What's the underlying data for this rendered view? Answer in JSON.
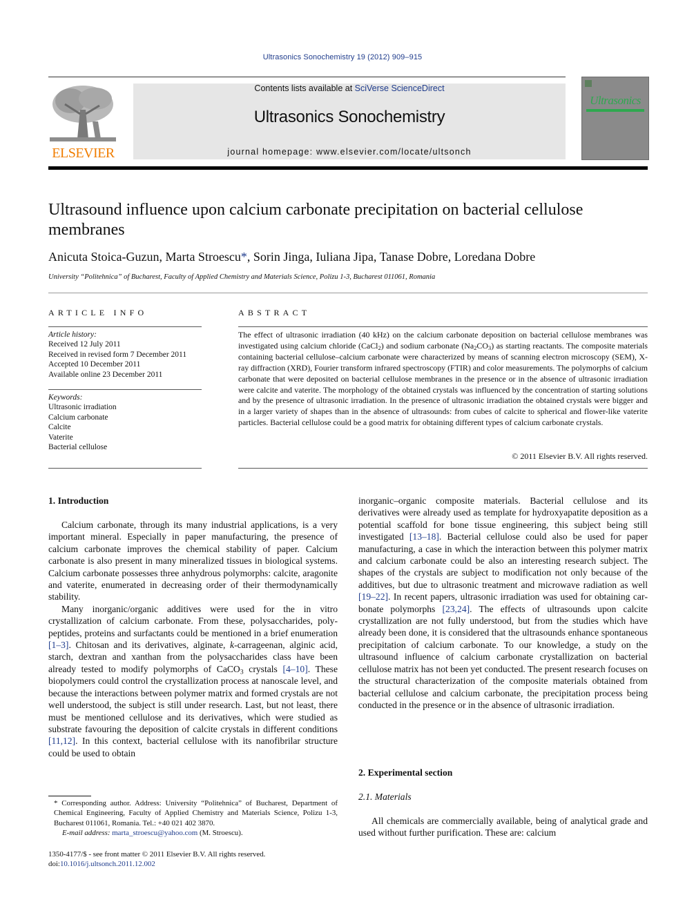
{
  "running_header": "Ultrasonics Sonochemistry 19 (2012) 909–915",
  "masthead": {
    "contents_prefix": "Contents lists available at ",
    "contents_link": "SciVerse ScienceDirect",
    "journal_name": "Ultrasonics Sonochemistry",
    "homepage_prefix": "journal homepage: ",
    "homepage_url": "www.elsevier.com/locate/ultsonch",
    "publisher_logo_text": "ELSEVIER",
    "cover_title": "Ultrasonics",
    "colors": {
      "masthead_bg": "#e6e6e6",
      "elsevier_orange": "#f07d00",
      "link_blue": "#1f3c8c",
      "cover_green": "#2fa84f",
      "cover_gray": "#8a8a8a"
    }
  },
  "article": {
    "title": "Ultrasound influence upon calcium carbonate precipitation on bacterial cellulose membranes",
    "authors_before_star": "Anicuta Stoica-Guzun, Marta Stroescu",
    "corresponding_marker": "*",
    "authors_after_star": ", Sorin Jinga, Iuliana Jipa, Tanase Dobre, Loredana Dobre",
    "affiliation": "University “Politehnica” of Bucharest, Faculty of Applied Chemistry and Materials Science, Polizu 1-3, Bucharest 011061, Romania"
  },
  "article_info": {
    "heading": "ARTICLE INFO",
    "history_label": "Article history:",
    "history": [
      "Received 12 July 2011",
      "Received in revised form 7 December 2011",
      "Accepted 10 December 2011",
      "Available online 23 December 2011"
    ],
    "keywords_label": "Keywords:",
    "keywords": [
      "Ultrasonic irradiation",
      "Calcium carbonate",
      "Calcite",
      "Vaterite",
      "Bacterial cellulose"
    ]
  },
  "abstract": {
    "heading": "ABSTRACT",
    "part1": "The effect of ultrasonic irradiation (40 kHz) on the calcium carbonate deposition on bacterial cellulose membranes was investigated using calcium chloride (CaCl",
    "sub1": "2",
    "part2": ") and sodium carbonate (Na",
    "sub2": "2",
    "part3": "CO",
    "sub3": "3",
    "part4": ") as starting reactants. The composite materials containing bacterial cellulose–calcium carbonate were characterized by means of scanning electron microscopy (SEM), X-ray diffraction (XRD), Fourier transform infrared spectroscopy (FTIR) and color measurements. The polymorphs of calcium carbonate that were deposited on bacterial cellulose membranes in the presence or in the absence of ultrasonic irradiation were calcite and vaterite. The morphology of the obtained crystals was influenced by the concentration of starting solutions and by the presence of ultrasonic irradiation. In the presence of ultrasonic irradiation the obtained crystals were bigger and in a larger variety of shapes than in the absence of ultrasounds: from cubes of calcite to spherical and flower-like vaterite particles. Bacterial cellulose could be a good matrix for obtaining different types of calcium carbonate crystals.",
    "copyright": "© 2011 Elsevier B.V. All rights reserved."
  },
  "sections": {
    "intro_heading": "1. Introduction",
    "intro_p1": "Calcium carbonate, through its many industrial applications, is a very important mineral. Especially in paper manufacturing, the presence of calcium carbonate improves the chemical stability of paper. Calcium carbonate is also present in many mineralized tis­sues in biological systems. Calcium carbonate possesses three anhydrous polymorphs: calcite, aragonite and vaterite, enumer­ated in decreasing order of their thermodynamically stability.",
    "intro_p2_a": "Many inorganic/organic additives were used for the in vitro crystallization of calcium carbonate. From these, polysaccharides, poly-peptides, proteins and surfactants could be mentioned in a brief enumeration ",
    "ref_1_3": "[1–3]",
    "intro_p2_b": ". Chitosan and its derivatives, alginate, ",
    "intro_p2_k": "k",
    "intro_p2_c": "-carrageenan, alginic acid, starch, dextran and xanthan from the polysaccharides class have been already tested to modify poly­morphs of CaCO",
    "intro_p2_sub": "3",
    "intro_p2_d": " crystals ",
    "ref_4_10": "[4–10]",
    "intro_p2_e": ". These biopolymers could control the crystallization process at nanoscale level, and because the interactions between polymer matrix and formed crystals are not well understood, the subject is still under research. Last, but not least, there must be mentioned cellulose and its derivatives, which were studied as substrate favouring the deposition of calcite crys­tals in different conditions ",
    "ref_11_12": "[11,12]",
    "intro_p2_f": ". In this context, bacterial cellu­lose with its nanofibrilar structure could be used to obtain",
    "right_a": "inorganic–organic composite materials. Bacterial cellulose and its derivatives were already used as template for hydroxyapatite deposition as a potential scaffold for bone tissue engineering, this subject being still investigated ",
    "ref_13_18": "[13–18]",
    "right_b": ". Bacterial cellulose could also be used for paper manufacturing, a case in which the interac­tion between this polymer matrix and calcium carbonate could be also an interesting research subject. The shapes of the crystals are subject to modification not only because of the additives, but due to ultrasonic treatment and microwave radiation as well ",
    "ref_19_22": "[19–22]",
    "right_c": ". In recent papers, ultrasonic irradiation was used for obtaining car­bonate polymorphs ",
    "ref_23_24": "[23,24]",
    "right_d": ". The effects of ultrasounds upon calcite crystallization are not fully understood, but from the studies which have already been done, it is considered that the ultrasounds en­hance spontaneous precipitation of calcium carbonate. To our knowledge, a study on the ultrasound influence of calcium carbon­ate crystallization on bacterial cellulose matrix has not been yet conducted. The present research focuses on the structural charac­terization of the composite materials obtained from bacterial cellu­lose and calcium carbonate, the precipitation process being conducted in the presence or in the absence of ultrasonic irradiation.",
    "exp_heading": "2. Experimental section",
    "materials_heading": "2.1. Materials",
    "materials_p": "All chemicals are commercially available, being of analytical grade and used without further purification. These are: calcium"
  },
  "footnote": {
    "marker": "*",
    "text": " Corresponding author. Address: University “Politehnica” of Bucharest, Depart­ment of Chemical Engineering, Faculty of Applied Chemistry and Materials Science, Polizu 1-3, Bucharest 011061, Romania. Tel.: +40 021 402 3870.",
    "email_label": "E-mail address: ",
    "email": "marta_stroescu@yahoo.com",
    "email_suffix": " (M. Stroescu).",
    "front_matter": "1350-4177/$ - see front matter © 2011 Elsevier B.V. All rights reserved.",
    "doi_prefix": "doi:",
    "doi": "10.1016/j.ultsonch.2011.12.002"
  }
}
